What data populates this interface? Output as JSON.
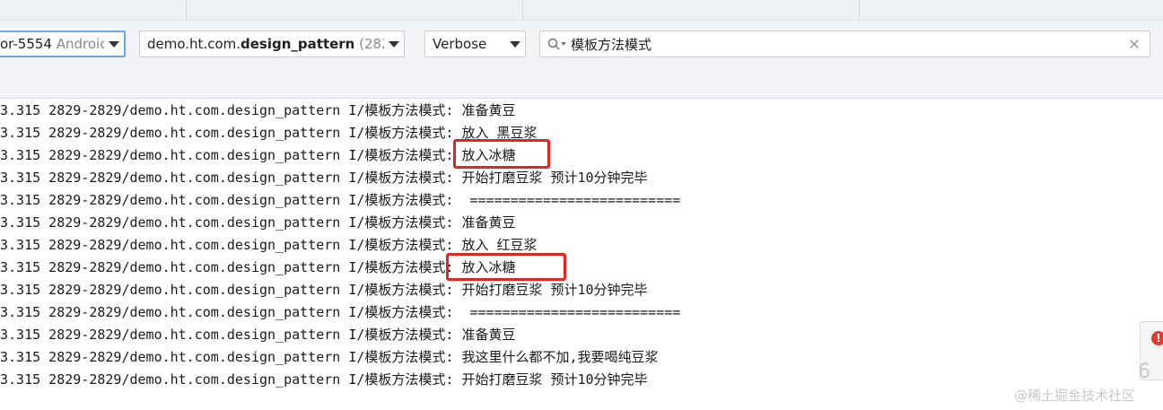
{
  "toolbar": {
    "device": {
      "prefix": "or-5554",
      "suffix": " Androic"
    },
    "process": {
      "prefix": "demo.ht.com.",
      "bold": "design_pattern",
      "suffix": " (2829"
    },
    "level": "Verbose",
    "search": {
      "value": "模板方法模式",
      "clear_label": "✕"
    }
  },
  "logs": [
    {
      "prefix": "3.315 2829-2829/demo.ht.com.design_pattern I/模板方法模式:",
      "message": " 准备黄豆"
    },
    {
      "prefix": "3.315 2829-2829/demo.ht.com.design_pattern I/模板方法模式:",
      "message": " 放入 黑豆浆"
    },
    {
      "prefix": "3.315 2829-2829/demo.ht.com.design_pattern I/模板方法模式:",
      "message": " 放入冰糖"
    },
    {
      "prefix": "3.315 2829-2829/demo.ht.com.design_pattern I/模板方法模式:",
      "message": " 开始打磨豆浆 预计10分钟完毕"
    },
    {
      "prefix": "3.315 2829-2829/demo.ht.com.design_pattern I/模板方法模式:",
      "message": "  =========================="
    },
    {
      "prefix": "3.315 2829-2829/demo.ht.com.design_pattern I/模板方法模式:",
      "message": " 准备黄豆"
    },
    {
      "prefix": "3.315 2829-2829/demo.ht.com.design_pattern I/模板方法模式:",
      "message": " 放入 红豆浆"
    },
    {
      "prefix": "3.315 2829-2829/demo.ht.com.design_pattern I/模板方法模式:",
      "message": " 放入冰糖"
    },
    {
      "prefix": "3.315 2829-2829/demo.ht.com.design_pattern I/模板方法模式:",
      "message": " 开始打磨豆浆 预计10分钟完毕"
    },
    {
      "prefix": "3.315 2829-2829/demo.ht.com.design_pattern I/模板方法模式:",
      "message": "  =========================="
    },
    {
      "prefix": "3.315 2829-2829/demo.ht.com.design_pattern I/模板方法模式:",
      "message": " 准备黄豆"
    },
    {
      "prefix": "3.315 2829-2829/demo.ht.com.design_pattern I/模板方法模式:",
      "message": " 我这里什么都不加,我要喝纯豆浆"
    },
    {
      "prefix": "3.315 2829-2829/demo.ht.com.design_pattern I/模板方法模式:",
      "message": " 开始打磨豆浆 预计10分钟完毕"
    }
  ],
  "side_badge": "!",
  "partial_digit": "6",
  "watermark": "@稀土掘金技术社区",
  "colors": {
    "highlight": "#e0261e",
    "focus": "#6fa5e6"
  }
}
